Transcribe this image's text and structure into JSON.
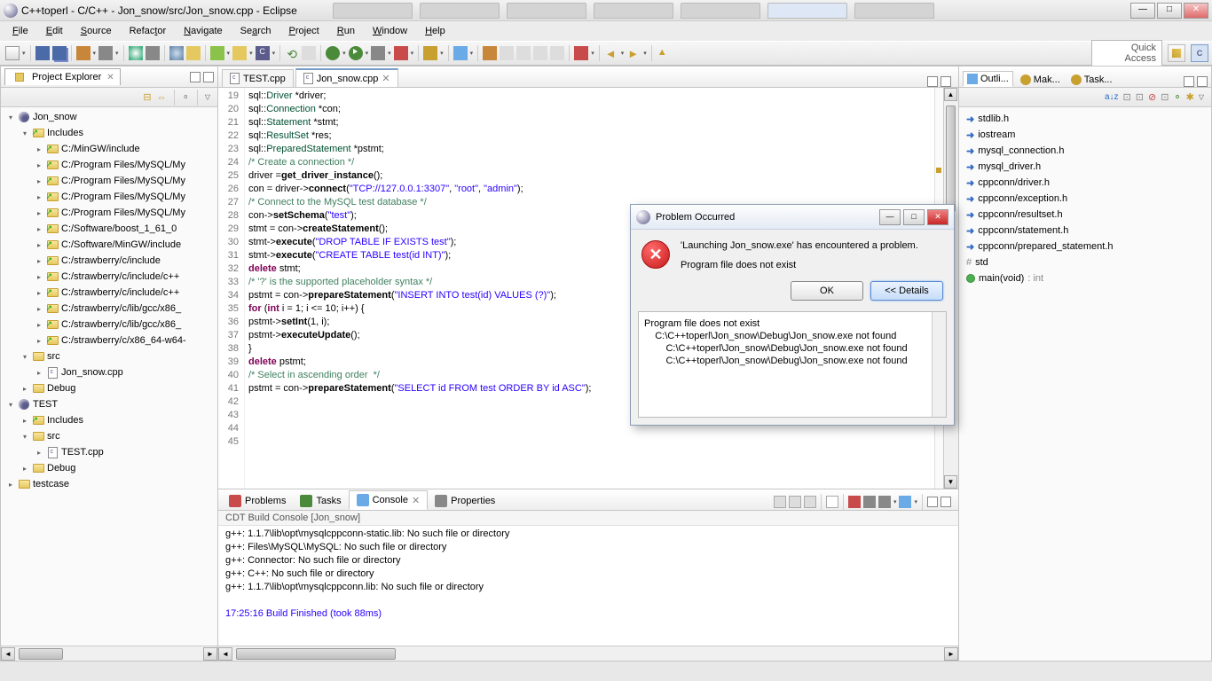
{
  "titlebar": {
    "title": "C++toperl - C/C++ - Jon_snow/src/Jon_snow.cpp - Eclipse"
  },
  "menubar": [
    {
      "u": "F",
      "rest": "ile"
    },
    {
      "u": "E",
      "rest": "dit"
    },
    {
      "u": "S",
      "rest": "ource"
    },
    {
      "pre": "Refac",
      "u": "t",
      "rest": "or"
    },
    {
      "u": "N",
      "rest": "avigate"
    },
    {
      "pre": "Se",
      "u": "a",
      "rest": "rch"
    },
    {
      "u": "P",
      "rest": "roject"
    },
    {
      "u": "R",
      "rest": "un"
    },
    {
      "u": "W",
      "rest": "indow"
    },
    {
      "u": "H",
      "rest": "elp"
    }
  ],
  "quick_access": "Quick Access",
  "project_explorer": {
    "title": "Project Explorer",
    "nodes": [
      {
        "depth": 0,
        "exp": "▾",
        "ic": "project",
        "label": "Jon_snow"
      },
      {
        "depth": 1,
        "exp": "▾",
        "ic": "inc-folder",
        "label": "Includes"
      },
      {
        "depth": 2,
        "exp": "▸",
        "ic": "inc-folder",
        "label": "C:/MinGW/include"
      },
      {
        "depth": 2,
        "exp": "▸",
        "ic": "inc-folder",
        "label": "C:/Program Files/MySQL/My"
      },
      {
        "depth": 2,
        "exp": "▸",
        "ic": "inc-folder",
        "label": "C:/Program Files/MySQL/My"
      },
      {
        "depth": 2,
        "exp": "▸",
        "ic": "inc-folder",
        "label": "C:/Program Files/MySQL/My"
      },
      {
        "depth": 2,
        "exp": "▸",
        "ic": "inc-folder",
        "label": "C:/Program Files/MySQL/My"
      },
      {
        "depth": 2,
        "exp": "▸",
        "ic": "inc-folder",
        "label": "C:/Software/boost_1_61_0"
      },
      {
        "depth": 2,
        "exp": "▸",
        "ic": "inc-folder",
        "label": "C:/Software/MinGW/include"
      },
      {
        "depth": 2,
        "exp": "▸",
        "ic": "inc-folder",
        "label": "C:/strawberry/c/include"
      },
      {
        "depth": 2,
        "exp": "▸",
        "ic": "inc-folder",
        "label": "C:/strawberry/c/include/c++"
      },
      {
        "depth": 2,
        "exp": "▸",
        "ic": "inc-folder",
        "label": "C:/strawberry/c/include/c++"
      },
      {
        "depth": 2,
        "exp": "▸",
        "ic": "inc-folder",
        "label": "C:/strawberry/c/lib/gcc/x86_"
      },
      {
        "depth": 2,
        "exp": "▸",
        "ic": "inc-folder",
        "label": "C:/strawberry/c/lib/gcc/x86_"
      },
      {
        "depth": 2,
        "exp": "▸",
        "ic": "inc-folder",
        "label": "C:/strawberry/c/x86_64-w64-"
      },
      {
        "depth": 1,
        "exp": "▾",
        "ic": "folder",
        "label": "src"
      },
      {
        "depth": 2,
        "exp": "▸",
        "ic": "file",
        "label": "Jon_snow.cpp"
      },
      {
        "depth": 1,
        "exp": "▸",
        "ic": "folder",
        "label": "Debug"
      },
      {
        "depth": 0,
        "exp": "▾",
        "ic": "project",
        "label": "TEST"
      },
      {
        "depth": 1,
        "exp": "▸",
        "ic": "inc-folder",
        "label": "Includes"
      },
      {
        "depth": 1,
        "exp": "▾",
        "ic": "folder",
        "label": "src"
      },
      {
        "depth": 2,
        "exp": "▸",
        "ic": "file",
        "label": "TEST.cpp"
      },
      {
        "depth": 1,
        "exp": "▸",
        "ic": "folder",
        "label": "Debug"
      },
      {
        "depth": 0,
        "exp": "▸",
        "ic": "folder",
        "label": "testcase"
      }
    ]
  },
  "editor": {
    "tabs": [
      {
        "label": "TEST.cpp",
        "active": false
      },
      {
        "label": "Jon_snow.cpp",
        "active": true
      }
    ],
    "first_line": 19
  },
  "bottom": {
    "tabs": [
      {
        "ic": "problems",
        "label": "Problems"
      },
      {
        "ic": "tasks",
        "label": "Tasks"
      },
      {
        "ic": "console",
        "label": "Console",
        "active": true
      },
      {
        "ic": "properties",
        "label": "Properties"
      }
    ],
    "console_label": "CDT Build Console [Jon_snow]",
    "console_lines": [
      "g++: 1.1.7\\lib\\opt\\mysqlcppconn-static.lib: No such file or directory",
      "g++: Files\\MySQL\\MySQL: No such file or directory",
      "g++: Connector: No such file or directory",
      "g++: C++: No such file or directory",
      "g++: 1.1.7\\lib\\opt\\mysqlcppconn.lib: No such file or directory",
      "",
      {
        "ts": true,
        "text": "17:25:16 Build Finished (took 88ms)"
      }
    ]
  },
  "outline": {
    "tabs": [
      {
        "label": "Outli...",
        "active": true
      },
      {
        "label": "Mak..."
      },
      {
        "label": "Task..."
      }
    ],
    "items": [
      {
        "ic": "inc",
        "label": "stdlib.h"
      },
      {
        "ic": "inc",
        "label": "iostream"
      },
      {
        "ic": "inc",
        "label": "mysql_connection.h"
      },
      {
        "ic": "inc",
        "label": "mysql_driver.h"
      },
      {
        "ic": "inc",
        "label": "cppconn/driver.h"
      },
      {
        "ic": "inc",
        "label": "cppconn/exception.h"
      },
      {
        "ic": "inc",
        "label": "cppconn/resultset.h"
      },
      {
        "ic": "inc",
        "label": "cppconn/statement.h"
      },
      {
        "ic": "inc",
        "label": "cppconn/prepared_statement.h"
      },
      {
        "ic": "ns",
        "label": "std"
      },
      {
        "ic": "fn",
        "label": "main(void)",
        "ret": ": int"
      }
    ]
  },
  "dialog": {
    "title": "Problem Occurred",
    "message1": "'Launching Jon_snow.exe' has encountered a problem.",
    "message2": "Program file does not exist",
    "ok": "OK",
    "details": "<< Details",
    "details_lines": [
      "Program file does not exist",
      "    C:\\C++toperl\\Jon_snow\\Debug\\Jon_snow.exe not found",
      "        C:\\C++toperl\\Jon_snow\\Debug\\Jon_snow.exe not found",
      "        C:\\C++toperl\\Jon_snow\\Debug\\Jon_snow.exe not found"
    ]
  }
}
